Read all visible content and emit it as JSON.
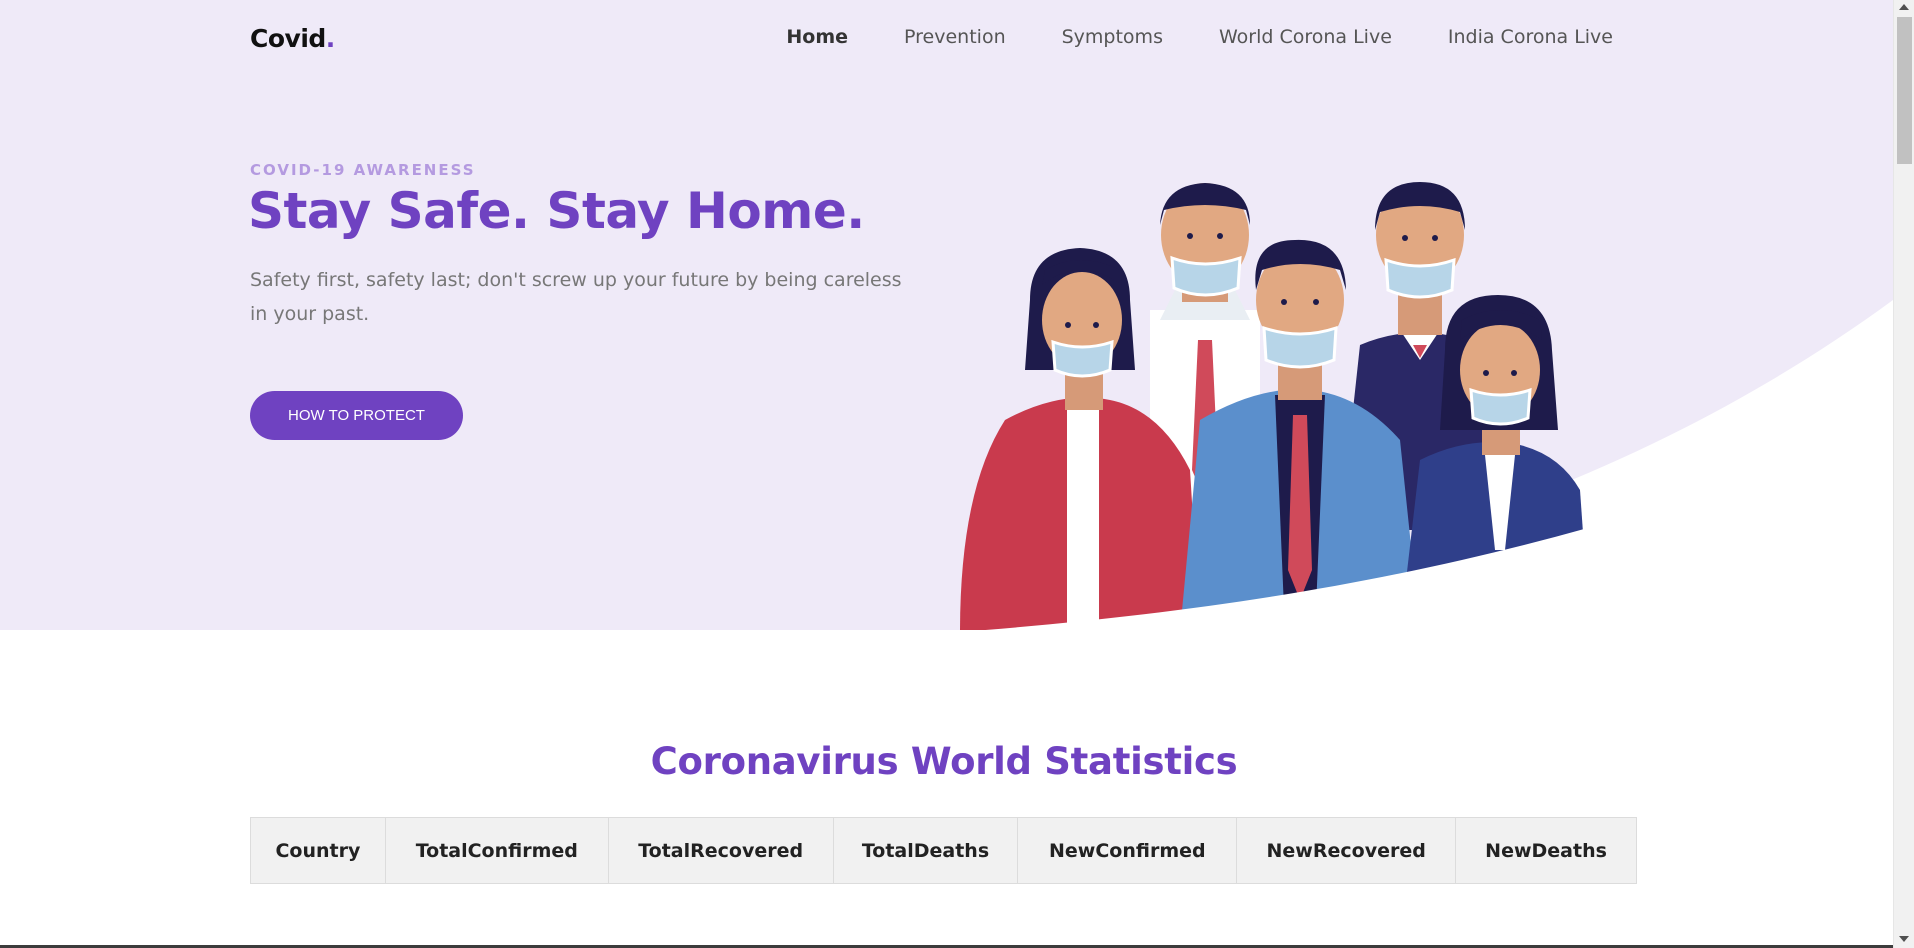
{
  "nav": {
    "logo": "Covid",
    "logo_dot": ".",
    "links": [
      "Home",
      "Prevention",
      "Symptoms",
      "World Corona Live",
      "India Corona Live"
    ],
    "active": "Home"
  },
  "hero": {
    "eyebrow": "COVID-19 AWARENESS",
    "title": "Stay Safe. Stay Home.",
    "text": "Safety first, safety last; don't screw up your future by being careless in your past.",
    "button": "HOW TO PROTECT"
  },
  "stats": {
    "title": "Coronavirus World Statistics",
    "columns": [
      "Country",
      "TotalConfirmed",
      "TotalRecovered",
      "TotalDeaths",
      "NewConfirmed",
      "NewRecovered",
      "NewDeaths"
    ]
  },
  "colors": {
    "accent": "#6f42c1",
    "hero_bg": "#efeaf8",
    "eyebrow": "#b49ae0"
  }
}
